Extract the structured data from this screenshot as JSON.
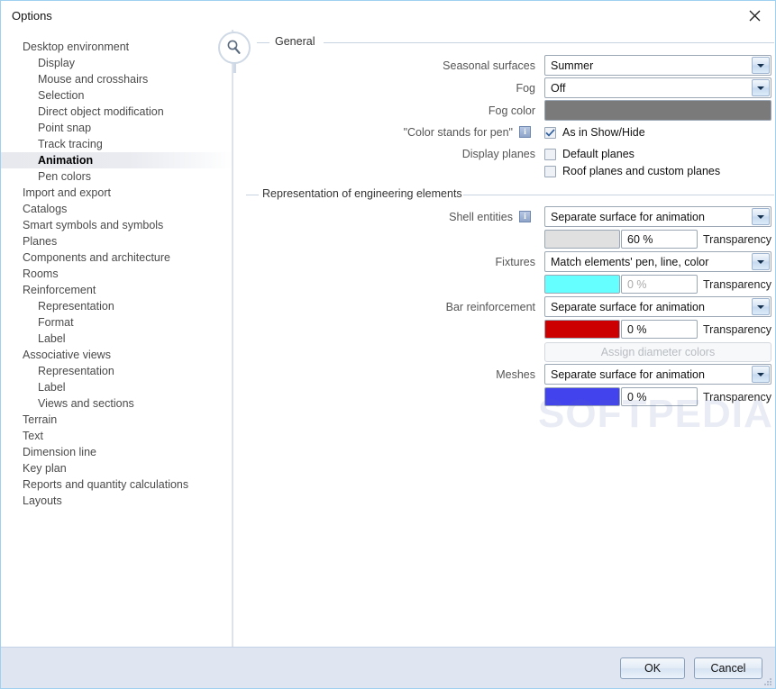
{
  "window": {
    "title": "Options",
    "close_icon": "close-icon"
  },
  "sidebar": {
    "info_icon": "info-icon",
    "items": [
      {
        "label": "Desktop environment",
        "level": 1,
        "selected": false
      },
      {
        "label": "Display",
        "level": 2,
        "selected": false
      },
      {
        "label": "Mouse and crosshairs",
        "level": 2,
        "selected": false
      },
      {
        "label": "Selection",
        "level": 2,
        "selected": false
      },
      {
        "label": "Direct object modification",
        "level": 2,
        "selected": false
      },
      {
        "label": "Point snap",
        "level": 2,
        "selected": false
      },
      {
        "label": "Track tracing",
        "level": 2,
        "selected": false
      },
      {
        "label": "Animation",
        "level": 2,
        "selected": true
      },
      {
        "label": "Pen colors",
        "level": 2,
        "selected": false
      },
      {
        "label": "Import and export",
        "level": 1,
        "selected": false
      },
      {
        "label": "Catalogs",
        "level": 1,
        "selected": false
      },
      {
        "label": "Smart symbols and symbols",
        "level": 1,
        "selected": false
      },
      {
        "label": "Planes",
        "level": 1,
        "selected": false
      },
      {
        "label": "Components and architecture",
        "level": 1,
        "selected": false
      },
      {
        "label": "Rooms",
        "level": 1,
        "selected": false
      },
      {
        "label": "Reinforcement",
        "level": 1,
        "selected": false
      },
      {
        "label": "Representation",
        "level": 2,
        "selected": false
      },
      {
        "label": "Format",
        "level": 2,
        "selected": false
      },
      {
        "label": "Label",
        "level": 2,
        "selected": false
      },
      {
        "label": "Associative views",
        "level": 1,
        "selected": false
      },
      {
        "label": "Representation",
        "level": 2,
        "selected": false
      },
      {
        "label": "Label",
        "level": 2,
        "selected": false
      },
      {
        "label": "Views and sections",
        "level": 2,
        "selected": false
      },
      {
        "label": "Terrain",
        "level": 1,
        "selected": false
      },
      {
        "label": "Text",
        "level": 1,
        "selected": false
      },
      {
        "label": "Dimension line",
        "level": 1,
        "selected": false
      },
      {
        "label": "Key plan",
        "level": 1,
        "selected": false
      },
      {
        "label": "Reports and quantity calculations",
        "level": 1,
        "selected": false
      },
      {
        "label": "Layouts",
        "level": 1,
        "selected": false
      }
    ]
  },
  "general": {
    "group_title": "General",
    "magnifier_icon": "magnifier-icon",
    "seasonal_surfaces": {
      "label": "Seasonal surfaces",
      "value": "Summer"
    },
    "fog": {
      "label": "Fog",
      "value": "Off"
    },
    "fog_color": {
      "label": "Fog color",
      "color": "#7a7a7a"
    },
    "color_stands_for_pen": {
      "label": "\"Color stands for pen\"",
      "info_icon": "info-icon",
      "checkbox_label": "As in Show/Hide",
      "checked": true
    },
    "display_planes": {
      "label": "Display planes",
      "options": [
        {
          "label": "Default planes",
          "checked": false
        },
        {
          "label": "Roof planes and custom planes",
          "checked": false
        }
      ]
    }
  },
  "representation": {
    "group_title": "Representation of engineering elements",
    "transparency_label": "Transparency",
    "assign_diameter_colors": {
      "label": "Assign diameter colors",
      "disabled": true
    },
    "rows": [
      {
        "label": "Shell entities",
        "info_icon": "info-icon",
        "has_info": true,
        "mode": "Separate surface for animation",
        "color": "#e0e0e0",
        "transparency": "60 %",
        "transparency_disabled": false
      },
      {
        "label": "Fixtures",
        "has_info": false,
        "mode": "Match elements' pen, line, color",
        "color": "#66ffff",
        "transparency": "0 %",
        "transparency_disabled": true
      },
      {
        "label": "Bar reinforcement",
        "has_info": false,
        "mode": "Separate surface for animation",
        "color": "#cc0000",
        "transparency": "0 %",
        "transparency_disabled": false
      },
      {
        "label": "Meshes",
        "has_info": false,
        "mode": "Separate surface for animation",
        "color": "#4343ee",
        "transparency": "0 %",
        "transparency_disabled": false
      }
    ]
  },
  "footer": {
    "ok_label": "OK",
    "cancel_label": "Cancel"
  },
  "watermark": {
    "text": "SOFTPEDIA",
    "mark": "®"
  }
}
